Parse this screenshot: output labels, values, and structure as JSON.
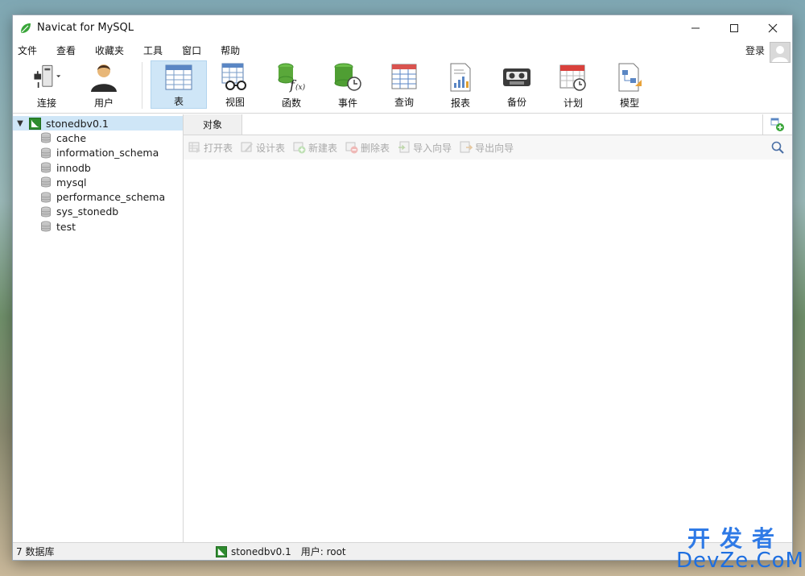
{
  "window": {
    "title": "Navicat for MySQL"
  },
  "menu": {
    "items": [
      "文件",
      "查看",
      "收藏夹",
      "工具",
      "窗口",
      "帮助"
    ],
    "login": "登录"
  },
  "toolbar": {
    "items": [
      {
        "label": "连接",
        "icon": "connection-plug-icon"
      },
      {
        "label": "用户",
        "icon": "user-icon"
      },
      {
        "label": "表",
        "icon": "table-icon",
        "active": true
      },
      {
        "label": "视图",
        "icon": "view-glasses-icon"
      },
      {
        "label": "函数",
        "icon": "function-icon"
      },
      {
        "label": "事件",
        "icon": "event-clock-icon"
      },
      {
        "label": "查询",
        "icon": "query-icon"
      },
      {
        "label": "报表",
        "icon": "report-icon"
      },
      {
        "label": "备份",
        "icon": "backup-tape-icon"
      },
      {
        "label": "计划",
        "icon": "schedule-calendar-icon"
      },
      {
        "label": "模型",
        "icon": "model-icon"
      }
    ]
  },
  "tree": {
    "connection": "stonedbv0.1",
    "databases": [
      "cache",
      "information_schema",
      "innodb",
      "mysql",
      "performance_schema",
      "sys_stonedb",
      "test"
    ]
  },
  "tabs": {
    "object_tab": "对象"
  },
  "object_toolbar": {
    "buttons": [
      "打开表",
      "设计表",
      "新建表",
      "删除表",
      "导入向导",
      "导出向导"
    ]
  },
  "status": {
    "db_count": "7 数据库",
    "connection": "stonedbv0.1",
    "user": "用户: root"
  },
  "watermark": {
    "cn": "开发者",
    "en": "DevZe.CoM"
  },
  "colors": {
    "selection": "#cfe6f7",
    "navicat_green": "#4caf2a",
    "disabled_text": "#a9a9a9"
  }
}
